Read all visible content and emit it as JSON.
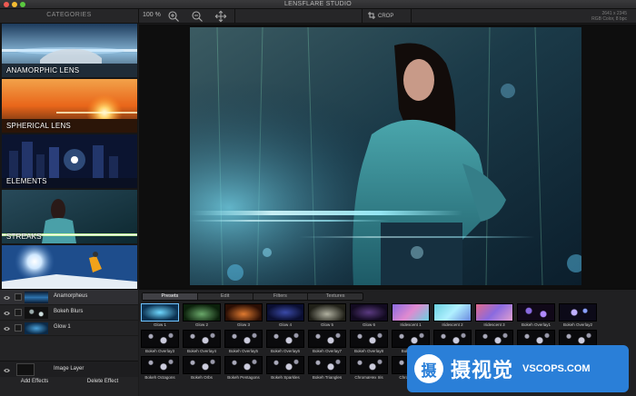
{
  "window": {
    "title": "LENSFLARE STUDIO"
  },
  "toolbar": {
    "categories_title": "CATEGORIES",
    "zoom_level": "100 %",
    "crop_label": "CROP",
    "image_size": "2641 x 2345",
    "image_color_mode": "RGB Color, 8 bpc"
  },
  "categories": [
    {
      "label": "ANAMORPHIC LENS"
    },
    {
      "label": "SPHERICAL LENS"
    },
    {
      "label": "ELEMENTS"
    },
    {
      "label": "STREAKS"
    },
    {
      "label": ""
    }
  ],
  "layers": {
    "items": [
      {
        "name": "Anamorpheus"
      },
      {
        "name": "Bokeh Blurs"
      },
      {
        "name": "Glow 1"
      }
    ],
    "image_layer": "Image Layer",
    "add_effects": "Add Effects",
    "delete_effect": "Delete Effect"
  },
  "panel": {
    "tabs": [
      "Presets",
      "Edit",
      "Filters",
      "Textures"
    ],
    "active_tab": "Presets",
    "presets": [
      "Glow 1",
      "Glow 2",
      "Glow 3",
      "Glow 4",
      "Glow 5",
      "Glow 6",
      "Iridescent 1",
      "Iridescent 2",
      "Iridescent 3",
      "Bokeh Overlay1",
      "Bokeh Overlay2",
      "Bokeh Overlay3",
      "Bokeh Overlay4",
      "Bokeh Overlay5",
      "Bokeh Overlay6",
      "Bokeh Overlay7",
      "Bokeh Overlay8",
      "Bokeh Blu",
      "",
      "",
      "",
      "",
      "Bokeh Octagons",
      "Bokeh Orbs",
      "Bokeh Pentagons",
      "Bokeh Sparkles",
      "Bokeh Triangles",
      "ChromaHex Iris",
      "ChromaRing",
      "",
      "",
      "",
      ""
    ]
  },
  "watermark": {
    "logo_glyph": "摄",
    "cn_text": "摄视觉",
    "en_text": "VSCOPS.COM"
  }
}
